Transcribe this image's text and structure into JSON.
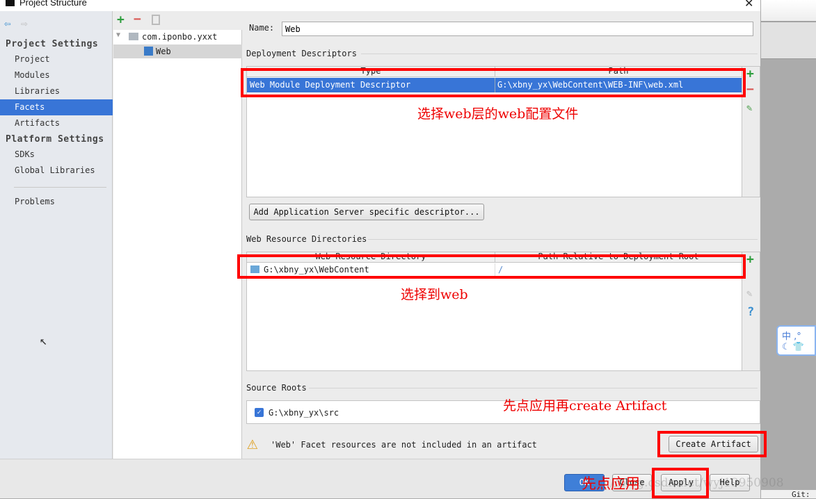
{
  "window": {
    "title": "Project Structure"
  },
  "sidebar": {
    "project_settings_header": "Project Settings",
    "project_items": [
      {
        "label": "Project"
      },
      {
        "label": "Modules"
      },
      {
        "label": "Libraries"
      },
      {
        "label": "Facets",
        "selected": true
      },
      {
        "label": "Artifacts"
      }
    ],
    "platform_settings_header": "Platform Settings",
    "platform_items": [
      {
        "label": "SDKs"
      },
      {
        "label": "Global Libraries"
      }
    ],
    "problems": "Problems"
  },
  "tree": {
    "root": "com.iponbo.yxxt",
    "child": "Web"
  },
  "facet": {
    "name_label": "Name:",
    "name_value": "Web",
    "deployment_descriptors": {
      "title": "Deployment Descriptors",
      "columns": [
        "Type",
        "Path"
      ],
      "rows": [
        {
          "type": "Web Module Deployment Descriptor",
          "path": "G:\\xbny_yx\\WebContent\\WEB-INF\\web.xml"
        }
      ]
    },
    "add_server_descriptor": "Add Application Server specific descriptor...",
    "web_resource_directories": {
      "title": "Web Resource Directories",
      "columns": [
        "Web Resource Directory",
        "Path Relative to Deployment Root"
      ],
      "rows": [
        {
          "dir": "G:\\xbny_yx\\WebContent",
          "path": "/"
        }
      ]
    },
    "source_roots": {
      "title": "Source Roots",
      "items": [
        {
          "path": "G:\\xbny_yx\\src",
          "checked": true
        }
      ]
    },
    "warning": "'Web' Facet resources are not included in an artifact",
    "create_artifact": "Create Artifact"
  },
  "buttons": {
    "ok": "OK",
    "close": "Close",
    "apply": "Apply",
    "help": "Help"
  },
  "annotations": {
    "a1": "选择web层的web配置文件",
    "a2": "选择到web",
    "a3": "先点应用再create Artifact",
    "a4": "先点应用"
  },
  "watermark": "http://blog.csdn.net/wyj19950908",
  "background": {
    "status": "Git:",
    "ime": "中 ,°"
  },
  "colors": {
    "selection": "#3875d7",
    "annotation": "#ff0000",
    "add": "#2e9e3e",
    "remove": "#d9534f"
  }
}
